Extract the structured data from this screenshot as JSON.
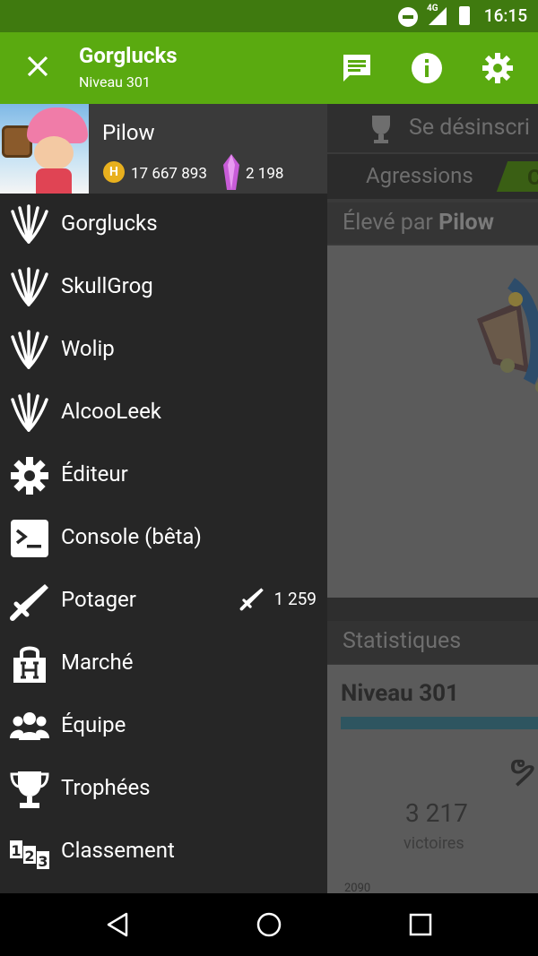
{
  "status_bar": {
    "time": "16:15",
    "network": "4G",
    "icons": [
      "do-not-disturb-icon",
      "signal-icon",
      "battery-icon"
    ]
  },
  "app_bar": {
    "title": "Gorglucks",
    "subtitle": "Niveau 301",
    "icons": [
      "close-icon",
      "chat-icon",
      "info-icon",
      "settings-icon"
    ]
  },
  "drawer": {
    "player_name": "Pilow",
    "habs": "17 667 893",
    "crystals": "2 198",
    "items": [
      {
        "label": "Gorglucks",
        "icon": "leek-icon"
      },
      {
        "label": "SkullGrog",
        "icon": "leek-icon"
      },
      {
        "label": "Wolip",
        "icon": "leek-icon"
      },
      {
        "label": "AlcooLeek",
        "icon": "leek-icon"
      },
      {
        "label": "Éditeur",
        "icon": "gear-icon"
      },
      {
        "label": "Console (bêta)",
        "icon": "terminal-icon"
      },
      {
        "label": "Potager",
        "icon": "sword-icon",
        "badge": "1 259"
      },
      {
        "label": "Marché",
        "icon": "market-icon"
      },
      {
        "label": "Équipe",
        "icon": "team-icon"
      },
      {
        "label": "Trophées",
        "icon": "trophy-icon"
      },
      {
        "label": "Classement",
        "icon": "ranking-icon"
      }
    ]
  },
  "background": {
    "unsubscribe_label": "Se désinscri",
    "tab_aggressions": "Agressions",
    "tab_other": "C",
    "raised_by_prefix": "Élevé par ",
    "raised_by_name": "Pilow",
    "stats_title": "Statistiques",
    "level": "Niveau 301",
    "victories_count": "3 217",
    "victories_label": "victoires",
    "year_label": "2090"
  },
  "colors": {
    "app_bar": "#5aaa10",
    "status_bar": "#3f7a0f",
    "drawer_bg": "#262626",
    "drawer_header": "#3a3a3a"
  }
}
